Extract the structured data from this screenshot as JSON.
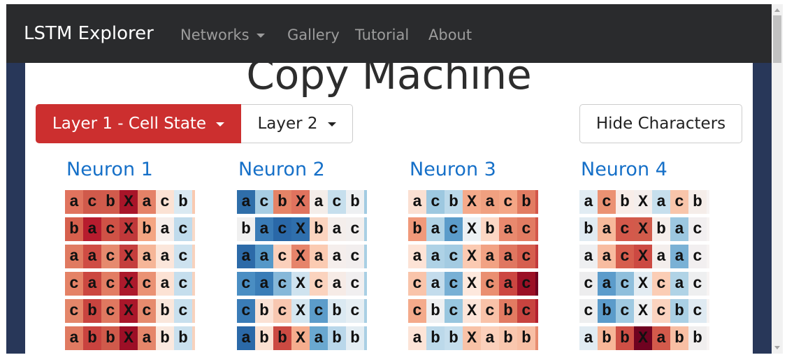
{
  "navbar": {
    "brand": "LSTM Explorer",
    "links": [
      {
        "label": "Networks",
        "has_dropdown": true
      },
      {
        "label": "Gallery"
      },
      {
        "label": "Tutorial"
      },
      {
        "label": "About"
      }
    ]
  },
  "page": {
    "title": "Copy Machine"
  },
  "controls": {
    "layer1_label": "Layer 1 - Cell State",
    "layer2_label": "Layer 2",
    "hide_characters_label": "Hide Characters",
    "active_color": "#cc2f2f"
  },
  "neurons": [
    {
      "title": "Neuron 1",
      "rows": [
        {
          "chars": [
            "a",
            "c",
            "b",
            "X",
            "a",
            "c",
            "b"
          ],
          "colors": [
            "#e0735e",
            "#d05a4b",
            "#d15b4c",
            "#a81529",
            "#e58267",
            "#fbe2d4",
            "#dae9f2",
            "#f9c9b0"
          ]
        },
        {
          "chars": [
            "b",
            "a",
            "c",
            "X",
            "b",
            "a",
            "c"
          ],
          "colors": [
            "#d6604d",
            "#b71c2e",
            "#cf5246",
            "#c0383a",
            "#f4a582",
            "#f6eeeb",
            "#c0dbec",
            "#f8d9c7"
          ]
        },
        {
          "chars": [
            "a",
            "a",
            "c",
            "X",
            "a",
            "a",
            "c"
          ],
          "colors": [
            "#e07a61",
            "#cf4c44",
            "#e68a6e",
            "#c53e3d",
            "#f6b698",
            "#fbe6db",
            "#cde2ef",
            "#f8d2bd"
          ]
        },
        {
          "chars": [
            "c",
            "a",
            "c",
            "X",
            "c",
            "a",
            "c"
          ],
          "colors": [
            "#e48266",
            "#cb4740",
            "#e27d63",
            "#ac1a2c",
            "#ea9274",
            "#fce2d4",
            "#c5deed",
            "#f8d2bd"
          ]
        },
        {
          "chars": [
            "c",
            "b",
            "c",
            "X",
            "c",
            "b",
            "c"
          ],
          "colors": [
            "#e4866a",
            "#c9443f",
            "#e07860",
            "#aa172a",
            "#e68b6e",
            "#fae7dc",
            "#c8e0ee",
            "#f8d2bd"
          ]
        },
        {
          "chars": [
            "a",
            "b",
            "b",
            "X",
            "a",
            "b",
            "b"
          ],
          "colors": [
            "#e07a61",
            "#c9433f",
            "#d05a4b",
            "#9c0f26",
            "#e5866a",
            "#fae9df",
            "#c9e0ee",
            "#f8d2bd"
          ]
        }
      ]
    },
    {
      "title": "Neuron 2",
      "rows": [
        {
          "chars": [
            "a",
            "c",
            "b",
            "X",
            "a",
            "c",
            "b"
          ],
          "colors": [
            "#2f6ea9",
            "#a7cde3",
            "#e58366",
            "#e0735e",
            "#f4ede9",
            "#c6dfed",
            "#eef0f2",
            "#a2cbe2"
          ]
        },
        {
          "chars": [
            "b",
            "a",
            "c",
            "X",
            "b",
            "a",
            "c"
          ],
          "colors": [
            "#f0f0f0",
            "#3a7cb7",
            "#2a68a8",
            "#2f6fad",
            "#fbd4bf",
            "#f4eeeb",
            "#f2efee",
            "#a9cfe4"
          ]
        },
        {
          "chars": [
            "a",
            "a",
            "c",
            "X",
            "a",
            "a",
            "c"
          ],
          "colors": [
            "#2c6aa8",
            "#5598c8",
            "#fbd0bb",
            "#e6846a",
            "#fbcbb2",
            "#f5eeec",
            "#f2eeee",
            "#a9cfe4"
          ]
        },
        {
          "chars": [
            "c",
            "a",
            "c",
            "X",
            "c",
            "a",
            "c"
          ],
          "colors": [
            "#4a8ec3",
            "#3a7db7",
            "#86b8d9",
            "#cfe3ef",
            "#fbd3be",
            "#f6ebe6",
            "#f1eff0",
            "#a9cfe4"
          ]
        },
        {
          "chars": [
            "c",
            "b",
            "c",
            "X",
            "c",
            "b",
            "c"
          ],
          "colors": [
            "#3a7cb7",
            "#fbe2d5",
            "#f8c7b0",
            "#d5e6f0",
            "#5c9cca",
            "#dbe9f2",
            "#e6eef3",
            "#a9cfe4"
          ]
        },
        {
          "chars": [
            "a",
            "b",
            "b",
            "X",
            "a",
            "b",
            "b"
          ],
          "colors": [
            "#2b69a8",
            "#fbe0d1",
            "#cb4a42",
            "#f5ad8e",
            "#6aa8d0",
            "#b9d7ea",
            "#e3edf3",
            "#a9cfe4"
          ]
        }
      ]
    },
    {
      "title": "Neuron 3",
      "rows": [
        {
          "chars": [
            "a",
            "c",
            "b",
            "X",
            "a",
            "c",
            "b"
          ],
          "colors": [
            "#fbe0d2",
            "#9dc8e0",
            "#bbd9ea",
            "#f5aa8b",
            "#f0a080",
            "#f4a686",
            "#e27c62",
            "#d3574a"
          ]
        },
        {
          "chars": [
            "b",
            "a",
            "c",
            "X",
            "b",
            "a",
            "c"
          ],
          "colors": [
            "#f0997a",
            "#b0d3e6",
            "#5b9cca",
            "#edf1f4",
            "#fcd7c4",
            "#e9896e",
            "#e27b62",
            "#d3574a"
          ]
        },
        {
          "chars": [
            "a",
            "a",
            "c",
            "X",
            "a",
            "a",
            "c"
          ],
          "colors": [
            "#fde3d6",
            "#aed2e6",
            "#a3cbe2",
            "#fbcab2",
            "#f2a283",
            "#e07760",
            "#d65e4e",
            "#c23a3c"
          ]
        },
        {
          "chars": [
            "c",
            "a",
            "c",
            "X",
            "c",
            "a",
            "c"
          ],
          "colors": [
            "#f9c4aa",
            "#c3dcec",
            "#78b0d5",
            "#fde8dd",
            "#ea8f71",
            "#cc4741",
            "#9b1025",
            "#6f0220"
          ]
        },
        {
          "chars": [
            "c",
            "b",
            "c",
            "X",
            "c",
            "b",
            "c"
          ],
          "colors": [
            "#f4aa8b",
            "#eef0f2",
            "#98c6df",
            "#fde5d9",
            "#f9c2a8",
            "#e27b62",
            "#c8433f",
            "#b2202f"
          ]
        },
        {
          "chars": [
            "a",
            "b",
            "b",
            "X",
            "a",
            "b",
            "b"
          ],
          "colors": [
            "#fde4d7",
            "#bcd9ea",
            "#c5deed",
            "#f8c2a7",
            "#fbd0bb",
            "#f9c7ae",
            "#f8bfa4",
            "#e88d70"
          ]
        }
      ]
    },
    {
      "title": "Neuron 4",
      "rows": [
        {
          "chars": [
            "a",
            "c",
            "b",
            "X",
            "a",
            "c",
            "b"
          ],
          "colors": [
            "#e1ecf3",
            "#eb9273",
            "#f8ede8",
            "#f4eeec",
            "#c6dfed",
            "#f8c5aa",
            "#f5ede9",
            "#f7f4f3"
          ]
        },
        {
          "chars": [
            "b",
            "a",
            "c",
            "X",
            "b",
            "a",
            "c"
          ],
          "colors": [
            "#e0ebf2",
            "#f7b99b",
            "#d4594b",
            "#d15b4b",
            "#f5eeeb",
            "#9cc7e0",
            "#f2eff0",
            "#f7f4f3"
          ]
        },
        {
          "chars": [
            "a",
            "a",
            "c",
            "X",
            "a",
            "a",
            "c"
          ],
          "colors": [
            "#eeeff1",
            "#f8bca0",
            "#d65d4d",
            "#cc4942",
            "#f4eeec",
            "#7ab1d5",
            "#f2eff0",
            "#f7f4f3"
          ]
        },
        {
          "chars": [
            "c",
            "a",
            "c",
            "X",
            "c",
            "a",
            "c"
          ],
          "colors": [
            "#ededee",
            "#5c9ccb",
            "#8fbfdc",
            "#e3ecf2",
            "#fbcdb5",
            "#b0d3e6",
            "#eeeff0",
            "#f7f4f3"
          ]
        },
        {
          "chars": [
            "c",
            "b",
            "c",
            "X",
            "c",
            "b",
            "c"
          ],
          "colors": [
            "#eeeff0",
            "#5b9bca",
            "#9fc9e1",
            "#eff0f1",
            "#fbd3bf",
            "#a9cfe4",
            "#dfeaf2",
            "#f7f4f3"
          ]
        },
        {
          "chars": [
            "a",
            "b",
            "b",
            "X",
            "a",
            "b",
            "b"
          ],
          "colors": [
            "#e0ebf2",
            "#f7b698",
            "#ce4f45",
            "#6f0220",
            "#d35a4b",
            "#f8bfa4",
            "#f0eeee",
            "#f7f4f3"
          ]
        }
      ]
    }
  ]
}
